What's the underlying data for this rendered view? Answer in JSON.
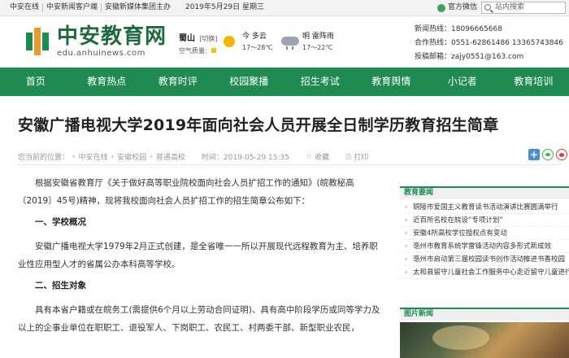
{
  "topbar": {
    "links": [
      "中安在线",
      "中安新闻客户端",
      "安徽新媒体集团主办"
    ],
    "date": "2019年5月29日 星期三",
    "weixin_label": "官方微信",
    "search_placeholder": "站内搜索"
  },
  "header": {
    "logo_text": "中安教育网",
    "logo_url": "edu.anhuinews.com",
    "city": {
      "name": "蜀山",
      "tag": "[切换]",
      "aq_label": "空气质量:"
    },
    "weather": [
      {
        "day": "今",
        "desc": "多云",
        "temp": "17～28℃",
        "icon": "sun-icon"
      },
      {
        "day": "明",
        "desc": "雷阵雨",
        "temp": "17～22℃",
        "icon": "rain-cloud-icon"
      }
    ],
    "contact": {
      "hotline": "新闻热线：18096665668",
      "coop": "合作热线：0551-62861486 13365743846",
      "email": "投稿邮箱：zajy0551@163.com"
    }
  },
  "nav": [
    "首页",
    "教育热点",
    "教育时评",
    "校园聚播",
    "招生考试",
    "教育舆情",
    "小记者",
    "教育培训"
  ],
  "article": {
    "title": "安徽广播电视大学2019年面向社会人员开展全日制学历教育招生简章",
    "breadcrumb_label": "您当前的位置：",
    "breadcrumb": [
      "中安在线",
      "安徽校园",
      "普通高校"
    ],
    "time": "时间：2019-05-29 15:35",
    "fav": "收藏",
    "print": "打印",
    "paragraphs": [
      {
        "type": "text",
        "text": "根据安徽省教育厅《关于做好高等职业院校面向社会人员扩招工作的通知》(皖教秘高〔2019〕45号)精神，现将我校面向社会人员扩招工作的招生简章公布如下："
      },
      {
        "type": "heading",
        "text": "一、学校概况"
      },
      {
        "type": "text",
        "text": "安徽广播电视大学1979年2月正式创建，是全省唯一一所以开展现代远程教育为主、培养职业性应用型人才的省属公办本科高等学校。"
      },
      {
        "type": "heading",
        "text": "二、招生对象"
      },
      {
        "type": "text",
        "text": "具有本省户籍或在皖务工(需提供6个月以上劳动合同证明)、具有高中阶段学历或同等学力及以上的企事业单位在职职工、退役军人、下岗职工、农民工、村两委干部、新型职业农民，"
      }
    ]
  },
  "sidebar": {
    "edu_title": "教育要闻",
    "edu_items": [
      "铜陵市爱国主义教育读书活动演讲比赛圆满举行",
      "近百所名校在皖设“专项计划”",
      "安徽4所高校学位授权点有变动",
      "亳州市教育系统学雷锋活动内容多形式新成效",
      "亳州市启动第三届校园读书创作活动推进书香校园",
      "太和县留守儿童社会工作服务中心走近留守儿童进行"
    ],
    "pic_title": "图片新闻"
  }
}
